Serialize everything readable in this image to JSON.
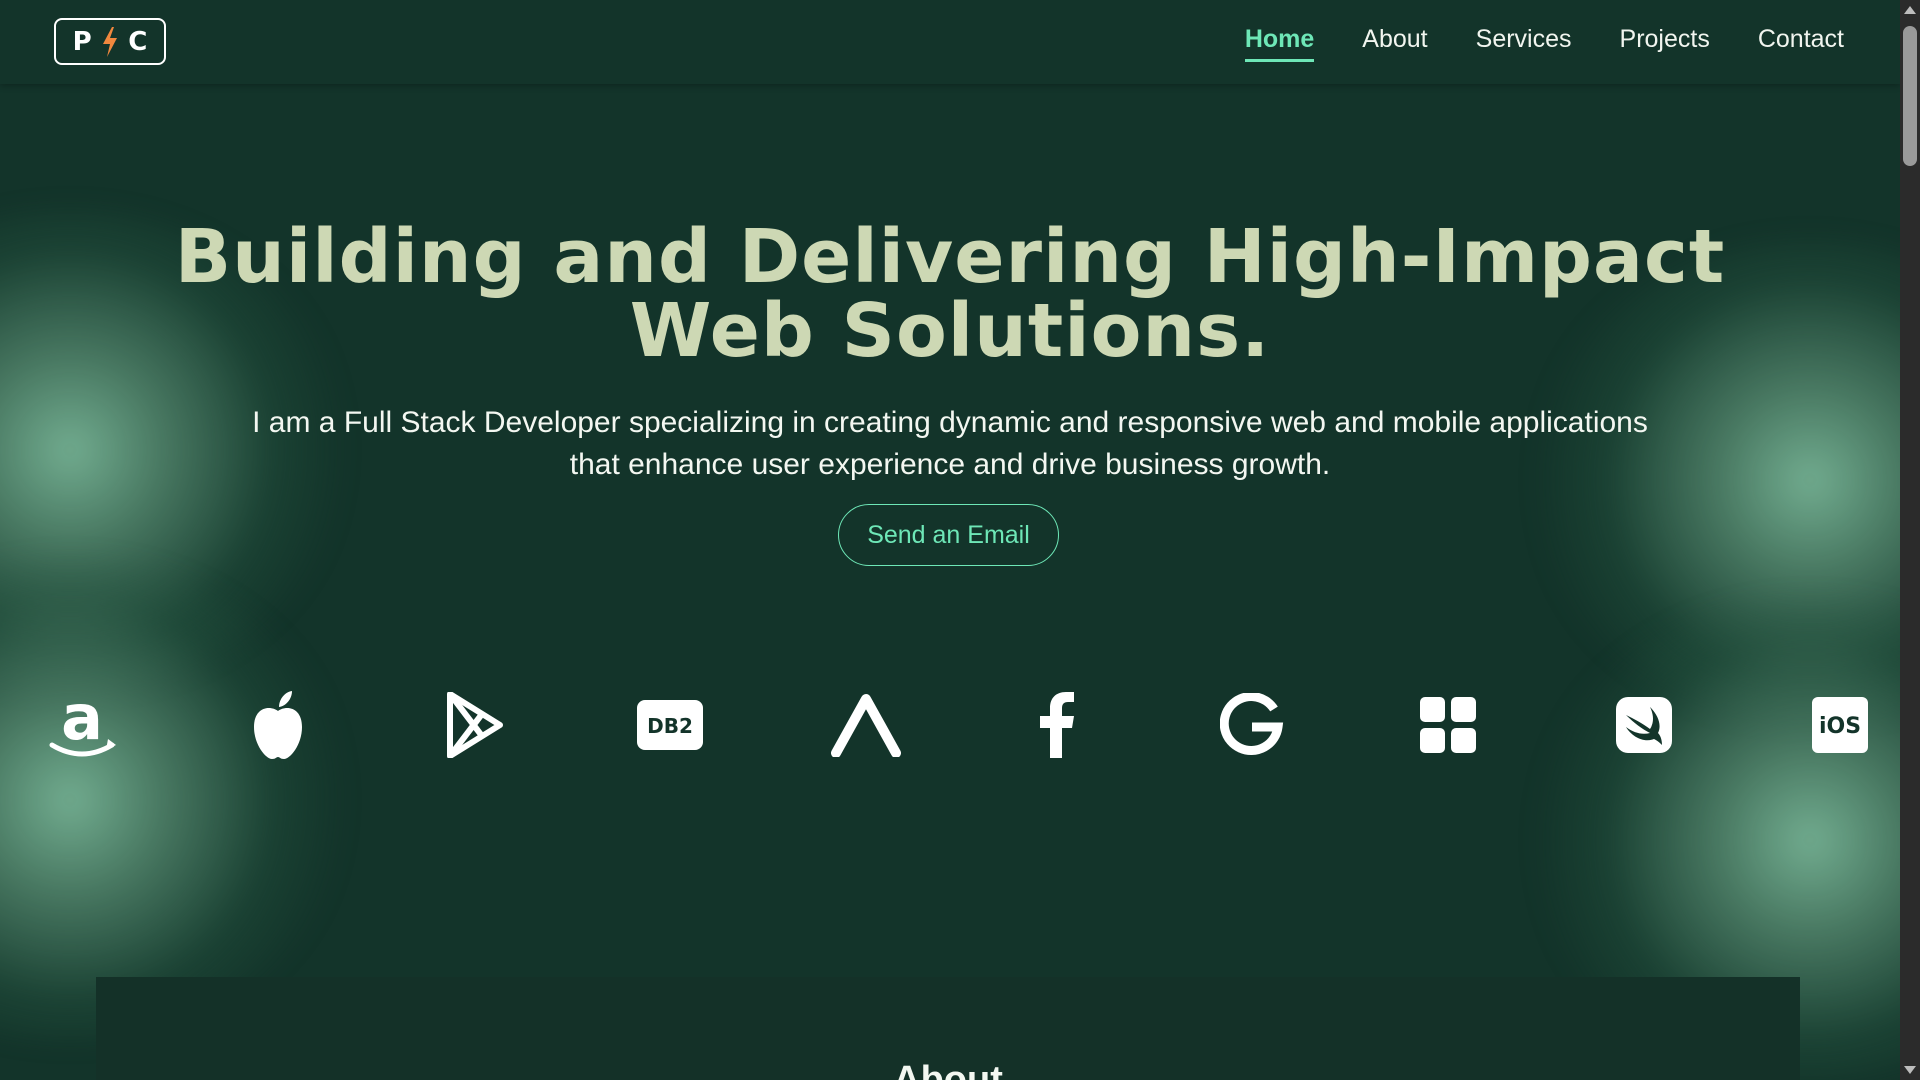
{
  "header": {
    "logo": {
      "left": "P",
      "right": "C",
      "bolt_color": "#f0883e"
    },
    "nav": [
      {
        "label": "Home",
        "active": true
      },
      {
        "label": "About",
        "active": false
      },
      {
        "label": "Services",
        "active": false
      },
      {
        "label": "Projects",
        "active": false
      },
      {
        "label": "Contact",
        "active": false
      }
    ]
  },
  "hero": {
    "title_line1": "Building and Delivering High-Impact",
    "title_line2": "Web Solutions.",
    "subtitle": "I am a Full Stack Developer specializing in creating dynamic and responsive web and mobile applications that enhance user experience and drive business growth.",
    "cta_label": "Send an Email"
  },
  "brands": {
    "items": [
      "amazon-icon",
      "apple-icon",
      "google-play-icon",
      "db2-icon",
      "arch-icon",
      "facebook-icon",
      "google-icon",
      "windows-grid-icon",
      "swift-icon",
      "ios-icon"
    ],
    "db2_label": "DB2",
    "ios_label": "iOS"
  },
  "about": {
    "title": "About"
  },
  "colors": {
    "background": "#13342a",
    "accent": "#6ee7b7",
    "title": "#cdd8b4"
  }
}
